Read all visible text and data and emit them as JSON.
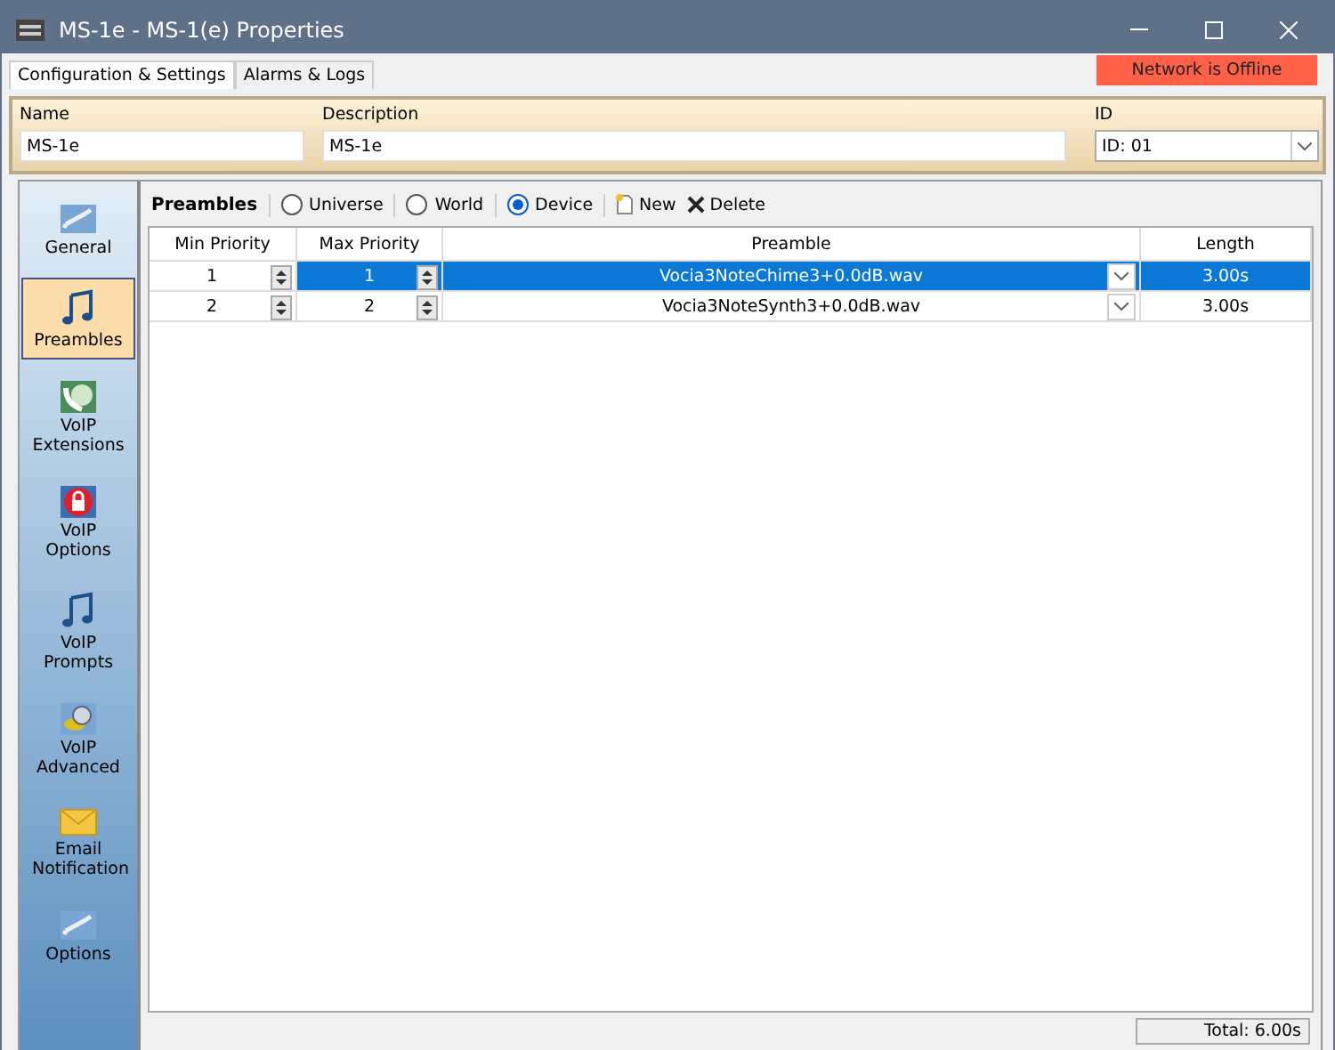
{
  "window": {
    "title": "MS-1e - MS-1(e) Properties"
  },
  "tabs": [
    {
      "label": "Configuration & Settings",
      "selected": true
    },
    {
      "label": "Alarms & Logs",
      "selected": false
    }
  ],
  "network_status": "Network is Offline",
  "fields": {
    "name": {
      "label": "Name",
      "value": "MS-1e"
    },
    "description": {
      "label": "Description",
      "value": "MS-1e"
    },
    "id": {
      "label": "ID",
      "value": "ID: 01"
    }
  },
  "sidebar": {
    "items": [
      {
        "label": "General",
        "selected": false
      },
      {
        "label": "Preambles",
        "selected": true
      },
      {
        "label": "VoIP Extensions",
        "selected": false
      },
      {
        "label": "VoIP Options",
        "selected": false
      },
      {
        "label": "VoIP Prompts",
        "selected": false
      },
      {
        "label": "VoIP Advanced",
        "selected": false
      },
      {
        "label": "Email Notification",
        "selected": false
      },
      {
        "label": "Options",
        "selected": false
      }
    ]
  },
  "toolbar": {
    "title": "Preambles",
    "scopes": [
      {
        "label": "Universe",
        "selected": false
      },
      {
        "label": "World",
        "selected": false
      },
      {
        "label": "Device",
        "selected": true
      }
    ],
    "new": "New",
    "delete": "Delete"
  },
  "table": {
    "columns": [
      "Min Priority",
      "Max Priority",
      "Preamble",
      "Length"
    ],
    "rows": [
      {
        "min": "1",
        "max": "1",
        "preamble": "Vocia3NoteChime3+0.0dB.wav",
        "length": "3.00s",
        "selected": true
      },
      {
        "min": "2",
        "max": "2",
        "preamble": "Vocia3NoteSynth3+0.0dB.wav",
        "length": "3.00s",
        "selected": false
      }
    ]
  },
  "total": "Total: 6.00s"
}
